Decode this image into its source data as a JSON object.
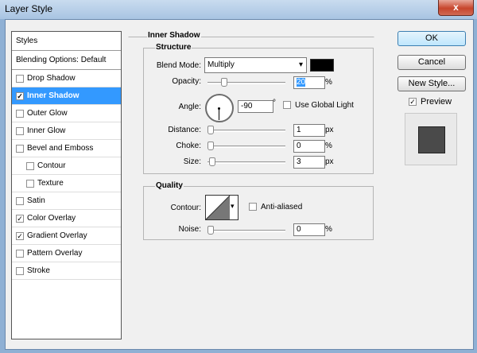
{
  "window": {
    "title": "Layer Style",
    "close_glyph": "x"
  },
  "styles_panel": {
    "header": "Styles",
    "blending_options": "Blending Options: Default",
    "items": [
      {
        "label": "Drop Shadow",
        "checked": false,
        "selected": false,
        "indent": false
      },
      {
        "label": "Inner Shadow",
        "checked": true,
        "selected": true,
        "indent": false
      },
      {
        "label": "Outer Glow",
        "checked": false,
        "selected": false,
        "indent": false
      },
      {
        "label": "Inner Glow",
        "checked": false,
        "selected": false,
        "indent": false
      },
      {
        "label": "Bevel and Emboss",
        "checked": false,
        "selected": false,
        "indent": false
      },
      {
        "label": "Contour",
        "checked": false,
        "selected": false,
        "indent": true
      },
      {
        "label": "Texture",
        "checked": false,
        "selected": false,
        "indent": true
      },
      {
        "label": "Satin",
        "checked": false,
        "selected": false,
        "indent": false
      },
      {
        "label": "Color Overlay",
        "checked": true,
        "selected": false,
        "indent": false
      },
      {
        "label": "Gradient Overlay",
        "checked": true,
        "selected": false,
        "indent": false
      },
      {
        "label": "Pattern Overlay",
        "checked": false,
        "selected": false,
        "indent": false
      },
      {
        "label": "Stroke",
        "checked": false,
        "selected": false,
        "indent": false
      }
    ]
  },
  "inner_shadow": {
    "section_title": "Inner Shadow",
    "structure_title": "Structure",
    "blend_mode_label": "Blend Mode:",
    "blend_mode_value": "Multiply",
    "blend_color": "#000000",
    "opacity_label": "Opacity:",
    "opacity_value": "20",
    "opacity_unit": "%",
    "angle_label": "Angle:",
    "angle_value": "-90",
    "angle_unit": "°",
    "use_global_light_label": "Use Global Light",
    "use_global_light_checked": false,
    "distance_label": "Distance:",
    "distance_value": "1",
    "distance_unit": "px",
    "choke_label": "Choke:",
    "choke_value": "0",
    "choke_unit": "%",
    "size_label": "Size:",
    "size_value": "3",
    "size_unit": "px",
    "quality_title": "Quality",
    "contour_label": "Contour:",
    "anti_aliased_label": "Anti-aliased",
    "anti_aliased_checked": false,
    "noise_label": "Noise:",
    "noise_value": "0",
    "noise_unit": "%"
  },
  "buttons": {
    "ok": "OK",
    "cancel": "Cancel",
    "new_style": "New Style..."
  },
  "preview": {
    "label": "Preview",
    "checked": true
  },
  "colors": {
    "selection": "#3399ff",
    "title_bar": "#b9d1ea"
  }
}
